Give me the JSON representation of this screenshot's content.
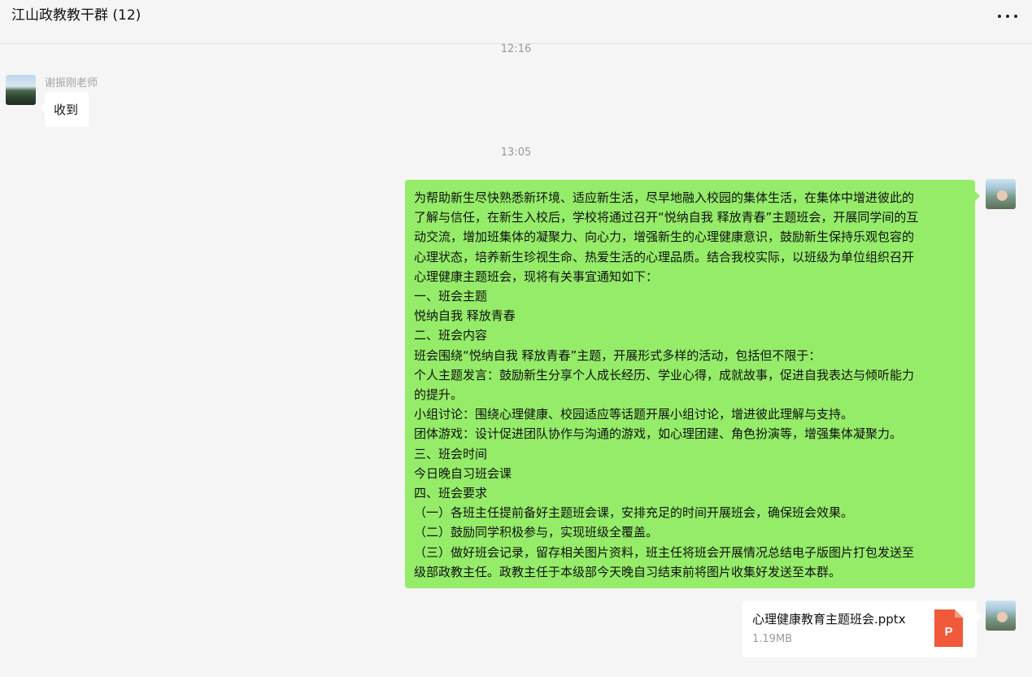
{
  "chat": {
    "title": "江山政教教干群",
    "member_count": "(12)"
  },
  "messages": {
    "time1": "12:16",
    "msg1": {
      "sender": "谢振刚老师",
      "text": "收到"
    },
    "time2": "13:05",
    "notice": {
      "lines": [
        "为帮助新生尽快熟悉新环境、适应新生活，尽早地融入校园的集体生活，在集体中增进彼此的",
        "了解与信任，在新生入校后，学校将通过召开“悦纳自我 释放青春”主题班会，开展同学间的互",
        "动交流，增加班集体的凝聚力、向心力，增强新生的心理健康意识，鼓励新生保持乐观包容的",
        "心理状态，培养新生珍视生命、热爱生活的心理品质。结合我校实际，以班级为单位组织召开",
        "心理健康主题班会，现将有关事宜通知如下：",
        "一、班会主题",
        "悦纳自我 释放青春",
        "二、班会内容",
        "班会围绕“悦纳自我 释放青春”主题，开展形式多样的活动，包括但不限于：",
        "个人主题发言：鼓励新生分享个人成长经历、学业心得，成就故事，促进自我表达与倾听能力",
        "的提升。",
        "小组讨论：围绕心理健康、校园适应等话题开展小组讨论，增进彼此理解与支持。",
        "团体游戏：设计促进团队协作与沟通的游戏，如心理团建、角色扮演等，增强集体凝聚力。",
        "三、班会时间",
        "今日晚自习班会课",
        "四、班会要求",
        "（一）各班主任提前备好主题班会课，安排充足的时间开展班会，确保班会效果。",
        "（二）鼓励同学积极参与，实现班级全覆盖。",
        "（三）做好班会记录，留存相关图片资料，班主任将班会开展情况总结电子版图片打包发送至",
        "级部政教主任。政教主任于本级部今天晚自习结束前将图片收集好发送至本群。"
      ]
    },
    "file": {
      "name": "心理健康教育主题班会.pptx",
      "size": "1.19MB",
      "icon_letter": "P",
      "icon_color": "#f0593a"
    }
  },
  "colors": {
    "background": "#f5f5f5",
    "self_bubble": "#95ec69",
    "other_bubble": "#ffffff"
  }
}
